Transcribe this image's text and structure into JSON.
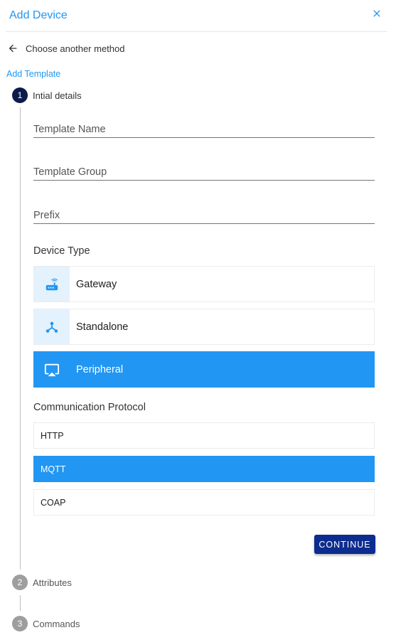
{
  "dialog": {
    "title": "Add Device",
    "back_label": "Choose another method",
    "section_title": "Add Template"
  },
  "steps": [
    {
      "number": "1",
      "label": "Intial details",
      "state": "active"
    },
    {
      "number": "2",
      "label": "Attributes",
      "state": "inactive"
    },
    {
      "number": "3",
      "label": "Commands",
      "state": "inactive"
    }
  ],
  "form": {
    "template_name": {
      "value": "",
      "placeholder": "Template Name"
    },
    "template_group": {
      "value": "",
      "placeholder": "Template Group"
    },
    "prefix": {
      "value": "",
      "placeholder": "Prefix"
    },
    "device_type_label": "Device Type",
    "device_types": [
      {
        "label": "Gateway",
        "icon": "router-icon",
        "selected": false
      },
      {
        "label": "Standalone",
        "icon": "hub-icon",
        "selected": false
      },
      {
        "label": "Peripheral",
        "icon": "airplay-icon",
        "selected": true
      }
    ],
    "protocol_label": "Communication Protocol",
    "protocols": [
      {
        "label": "HTTP",
        "selected": false
      },
      {
        "label": "MQTT",
        "selected": true
      },
      {
        "label": "COAP",
        "selected": false
      }
    ],
    "continue_label": "CONTINUE"
  },
  "colors": {
    "accent": "#2196f3",
    "accent_light": "#e3f2fd",
    "primary_dark": "#0d2c8f",
    "step_active": "#0d1b4b",
    "step_inactive": "#9e9e9e"
  }
}
